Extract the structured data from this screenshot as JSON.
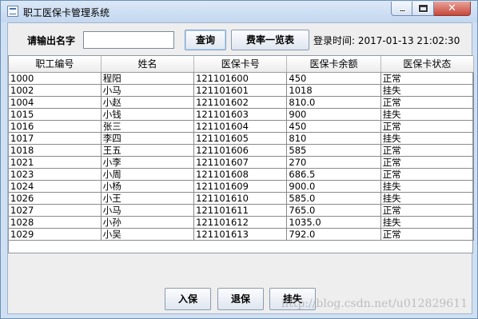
{
  "window": {
    "title": "职工医保卡管理系统",
    "close_glyph": "✕"
  },
  "search": {
    "prompt": "请输出名字",
    "value": "",
    "placeholder": ""
  },
  "toolbar": {
    "query_label": "查询",
    "rates_label": "费率一览表",
    "login_time_label": "登录时间:",
    "login_time_value": "2017-01-13 21:02:30"
  },
  "table": {
    "headers": [
      "职工编号",
      "姓名",
      "医保卡号",
      "医保卡余额",
      "医保卡状态"
    ],
    "rows": [
      [
        "1000",
        "程阳",
        "121101600",
        "450",
        "正常"
      ],
      [
        "1002",
        "小马",
        "121101601",
        "1018",
        "挂失"
      ],
      [
        "1004",
        "小赵",
        "121101602",
        "810.0",
        "正常"
      ],
      [
        "1015",
        "小钱",
        "121101603",
        "900",
        "挂失"
      ],
      [
        "1016",
        "张三",
        "121101604",
        "450",
        "正常"
      ],
      [
        "1017",
        "李四",
        "121101605",
        "810",
        "挂失"
      ],
      [
        "1018",
        "王五",
        "121101606",
        "585",
        "正常"
      ],
      [
        "1021",
        "小李",
        "121101607",
        "270",
        "正常"
      ],
      [
        "1023",
        "小周",
        "121101608",
        "686.5",
        "正常"
      ],
      [
        "1024",
        "小杨",
        "121101609",
        "900.0",
        "挂失"
      ],
      [
        "1026",
        "小王",
        "121101610",
        "585.0",
        "挂失"
      ],
      [
        "1027",
        "小马",
        "121101611",
        "765.0",
        "正常"
      ],
      [
        "1028",
        "小孙",
        "121101612",
        "1035.0",
        "挂失"
      ],
      [
        "1029",
        "小吴",
        "121101613",
        "792.0",
        "正常"
      ]
    ]
  },
  "actions": {
    "enroll_label": "入保",
    "withdraw_label": "退保",
    "report_loss_label": "挂失"
  },
  "watermark": "http://blog.csdn.net/u012829611",
  "colors": {
    "title_bar": "#c3d7ef",
    "client_bg": "#eeeeee",
    "close_button": "#c7473a"
  }
}
